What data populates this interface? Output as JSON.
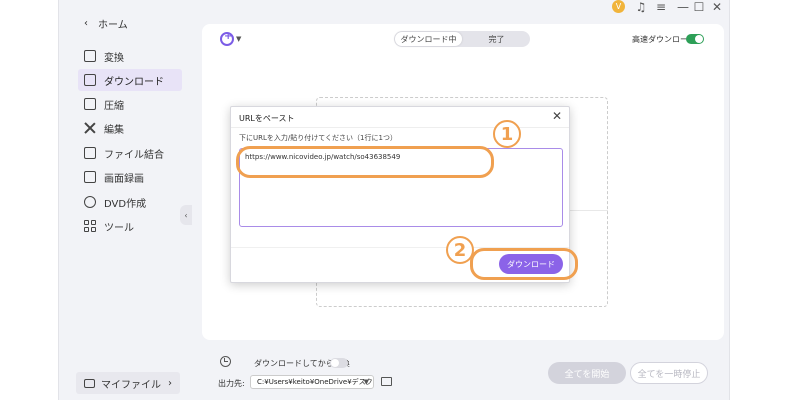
{
  "titlebar": {
    "avatar_letter": "V",
    "icons": [
      "headset-icon",
      "menu-icon",
      "minimize-icon",
      "maximize-icon",
      "close-icon"
    ]
  },
  "sidebar": {
    "home_label": "ホーム",
    "items": [
      {
        "label": "変換",
        "icon": "convert-icon"
      },
      {
        "label": "ダウンロード",
        "icon": "download-icon",
        "active": true
      },
      {
        "label": "圧縮",
        "icon": "compress-icon"
      },
      {
        "label": "編集",
        "icon": "scissors-icon"
      },
      {
        "label": "ファイル結合",
        "icon": "merge-icon"
      },
      {
        "label": "画面録画",
        "icon": "record-icon"
      },
      {
        "label": "DVD作成",
        "icon": "dvd-icon"
      },
      {
        "label": "ツール",
        "icon": "tools-grid-icon"
      }
    ],
    "myfiles_label": "マイファイル"
  },
  "main": {
    "tabs": [
      {
        "label": "ダウンロード中",
        "active": true
      },
      {
        "label": "完了",
        "active": false
      }
    ],
    "high_speed_label": "高速ダウンロード",
    "high_speed_on": true
  },
  "bottom": {
    "convert_after_label": "ダウンロードしてから変換",
    "convert_after_on": false,
    "output_label": "出力先:",
    "output_path": "C:¥Users¥keito¥OneDrive¥デスク",
    "start_all_label": "全てを開始",
    "pause_all_label": "全てを一時停止"
  },
  "dialog": {
    "title": "URLをペースト",
    "instruction": "下にURLを入力/貼り付けてください（1行に1つ）",
    "url_value": "https://www.nicovideo.jp/watch/so43638549",
    "download_label": "ダウンロード"
  },
  "annotations": {
    "step1": "1",
    "step2": "2",
    "color": "#f0a050"
  },
  "colors": {
    "accent": "#8b63e8",
    "toggle_on": "#2d9f57",
    "disabled_button": "#d3d3dc"
  }
}
